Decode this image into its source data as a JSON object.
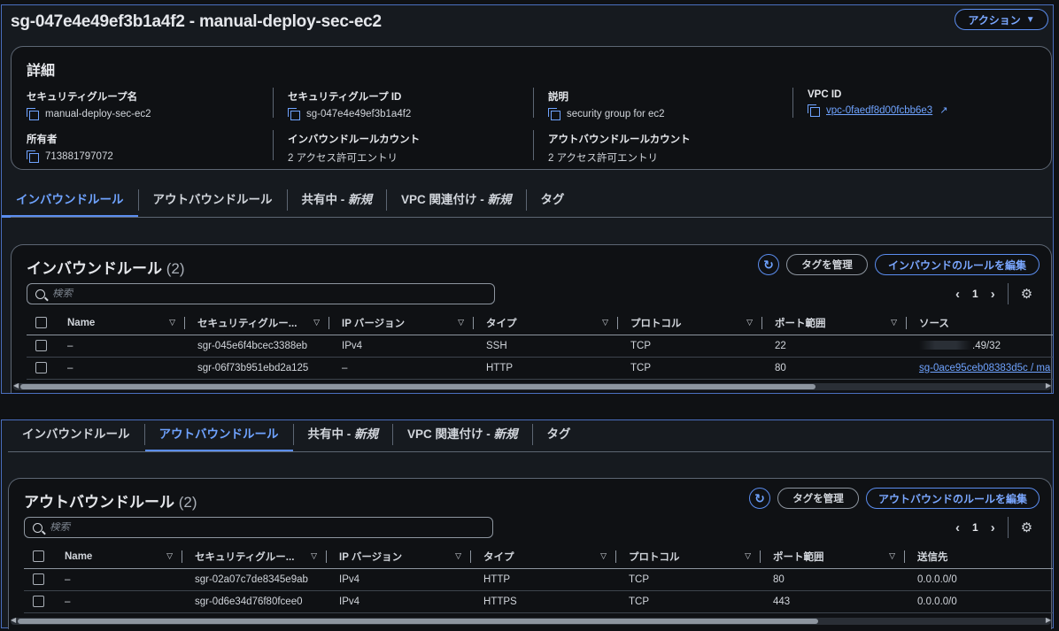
{
  "header": {
    "title": "sg-047e4e49ef3b1a4f2 - manual-deploy-sec-ec2",
    "action_label": "アクション"
  },
  "details": {
    "heading": "詳細",
    "sg_name_label": "セキュリティグループ名",
    "sg_name": "manual-deploy-sec-ec2",
    "sg_id_label": "セキュリティグループ ID",
    "sg_id": "sg-047e4e49ef3b1a4f2",
    "desc_label": "説明",
    "desc": "security group for ec2",
    "vpc_label": "VPC ID",
    "vpc_id": "vpc-0faedf8d00fcbb6e3",
    "owner_label": "所有者",
    "owner": "713881797072",
    "inbound_count_label": "インバウンドルールカウント",
    "inbound_count": "2 アクセス許可エントリ",
    "outbound_count_label": "アウトバウンドルールカウント",
    "outbound_count": "2 アクセス許可エントリ"
  },
  "tabs": {
    "inbound": "インバウンドルール",
    "outbound": "アウトバウンドルール",
    "sharing": "共有中 - ",
    "sharing_new": "新規",
    "vpc_assoc": "VPC 関連付け - ",
    "vpc_assoc_new": "新規",
    "tags": "タグ"
  },
  "inbound": {
    "title": "インバウンドルール",
    "count": "(2)",
    "manage_tags": "タグを管理",
    "edit_label": "インバウンドのルールを編集",
    "search_placeholder": "検索",
    "page": "1",
    "columns": [
      "Name",
      "セキュリティグルー...",
      "IP バージョン",
      "タイプ",
      "プロトコル",
      "ポート範囲",
      "ソース"
    ],
    "rows": [
      {
        "name": "–",
        "rule_id": "sgr-045e6f4bcec3388eb",
        "ip": "IPv4",
        "type": "SSH",
        "protocol": "TCP",
        "port": "22",
        "source": ".49/32"
      },
      {
        "name": "–",
        "rule_id": "sgr-06f73b951ebd2a125",
        "ip": "–",
        "type": "HTTP",
        "protocol": "TCP",
        "port": "80",
        "source": "sg-0ace95ceb08383d5c / ma"
      }
    ]
  },
  "outbound": {
    "title": "アウトバウンドルール",
    "count": "(2)",
    "manage_tags": "タグを管理",
    "edit_label": "アウトバウンドのルールを編集",
    "search_placeholder": "検索",
    "page": "1",
    "columns": [
      "Name",
      "セキュリティグルー...",
      "IP バージョン",
      "タイプ",
      "プロトコル",
      "ポート範囲",
      "送信先"
    ],
    "rows": [
      {
        "name": "–",
        "rule_id": "sgr-02a07c7de8345e9ab",
        "ip": "IPv4",
        "type": "HTTP",
        "protocol": "TCP",
        "port": "80",
        "dest": "0.0.0.0/0"
      },
      {
        "name": "–",
        "rule_id": "sgr-0d6e34d76f80fcee0",
        "ip": "IPv4",
        "type": "HTTPS",
        "protocol": "TCP",
        "port": "443",
        "dest": "0.0.0.0/0"
      }
    ]
  },
  "colors": {
    "accent": "#5b8def",
    "link": "#6fa3ff",
    "background": "#0f1114",
    "border": "#5d6673"
  }
}
